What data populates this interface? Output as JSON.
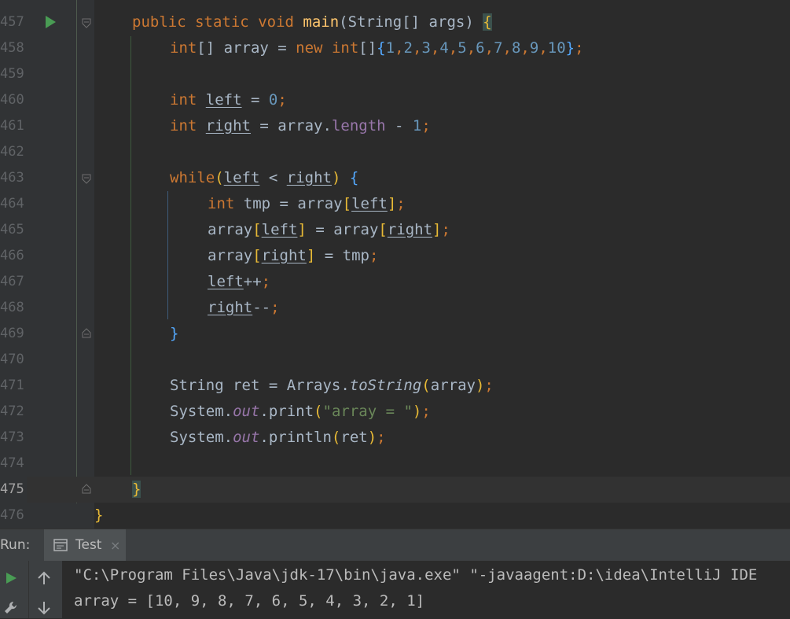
{
  "editor": {
    "current_line": "475",
    "lines": [
      {
        "num": "457"
      },
      {
        "num": "458"
      },
      {
        "num": "459"
      },
      {
        "num": "460"
      },
      {
        "num": "461"
      },
      {
        "num": "462"
      },
      {
        "num": "463"
      },
      {
        "num": "464"
      },
      {
        "num": "465"
      },
      {
        "num": "466"
      },
      {
        "num": "467"
      },
      {
        "num": "468"
      },
      {
        "num": "469"
      },
      {
        "num": "470"
      },
      {
        "num": "471"
      },
      {
        "num": "472"
      },
      {
        "num": "473"
      },
      {
        "num": "474"
      },
      {
        "num": "475"
      },
      {
        "num": "476"
      }
    ],
    "code": {
      "l457": {
        "public": "public",
        "static": "static",
        "void": "void",
        "main": "main",
        "rest": "(String[] args) ",
        "brace": "{"
      },
      "l458": {
        "int": "int",
        "arr": "[] array = ",
        "new": "new",
        "int2": "int",
        "br": "[]",
        "ob": "{",
        "n1": "1",
        "n2": "2",
        "n3": "3",
        "n4": "4",
        "n5": "5",
        "n6": "6",
        "n7": "7",
        "n8": "8",
        "n9": "9",
        "n10": "10",
        "cb": "}",
        "semi": ";"
      },
      "l460": {
        "int": "int",
        "var": "left",
        "eq": " = ",
        "val": "0",
        "semi": ";"
      },
      "l461": {
        "int": "int",
        "var": "right",
        "eq": " = array.",
        "field": "length",
        "op": " - ",
        "val": "1",
        "semi": ";"
      },
      "l463": {
        "while": "while",
        "open": "(",
        "left": "left",
        "op": " < ",
        "right": "right",
        "close": ")",
        "sp": " ",
        "brace": "{"
      },
      "l464": {
        "int": "int",
        "mid": " tmp = array",
        "ob": "[",
        "left": "left",
        "cb": "]",
        "semi": ";"
      },
      "l465": {
        "a1": "array",
        "ob1": "[",
        "left": "left",
        "cb1": "]",
        "eq": " = array",
        "ob2": "[",
        "right": "right",
        "cb2": "]",
        "semi": ";"
      },
      "l466": {
        "a1": "array",
        "ob": "[",
        "right": "right",
        "cb": "]",
        "eq": " = tmp",
        "semi": ";"
      },
      "l467": {
        "var": "left",
        "op": "++",
        "semi": ";"
      },
      "l468": {
        "var": "right",
        "op": "--",
        "semi": ";"
      },
      "l469": {
        "brace": "}"
      },
      "l471": {
        "a": "String ret = Arrays.",
        "fn": "toString",
        "op": "(",
        "arg": "array",
        "cp": ")",
        "semi": ";"
      },
      "l472": {
        "a": "System.",
        "out": "out",
        "b": ".print",
        "op": "(",
        "str": "\"array = \"",
        "cp": ")",
        "semi": ";"
      },
      "l473": {
        "a": "System.",
        "out": "out",
        "b": ".println",
        "op": "(",
        "arg": "ret",
        "cp": ")",
        "semi": ";"
      },
      "l475": {
        "brace": "}"
      },
      "l476": {
        "brace": "}"
      }
    }
  },
  "run_panel": {
    "label": "Run:",
    "tab_label": "Test",
    "tab_close": "×",
    "console_lines": [
      "\"C:\\Program Files\\Java\\jdk-17\\bin\\java.exe\" \"-javaagent:D:\\idea\\IntelliJ IDE",
      "array = [10, 9, 8, 7, 6, 5, 4, 3, 2, 1]"
    ]
  },
  "colors": {
    "keyword": "#cc7832",
    "function": "#ffc66d",
    "number": "#6897bb",
    "string": "#6a8759",
    "field": "#9876aa",
    "text": "#a9b7c6",
    "background": "#2b2b2b"
  },
  "icons": [
    "run-gutter-icon",
    "fold-icon",
    "console-icon",
    "close-icon",
    "rerun-icon",
    "arrow-up-icon",
    "wrench-icon",
    "arrow-down-icon"
  ]
}
